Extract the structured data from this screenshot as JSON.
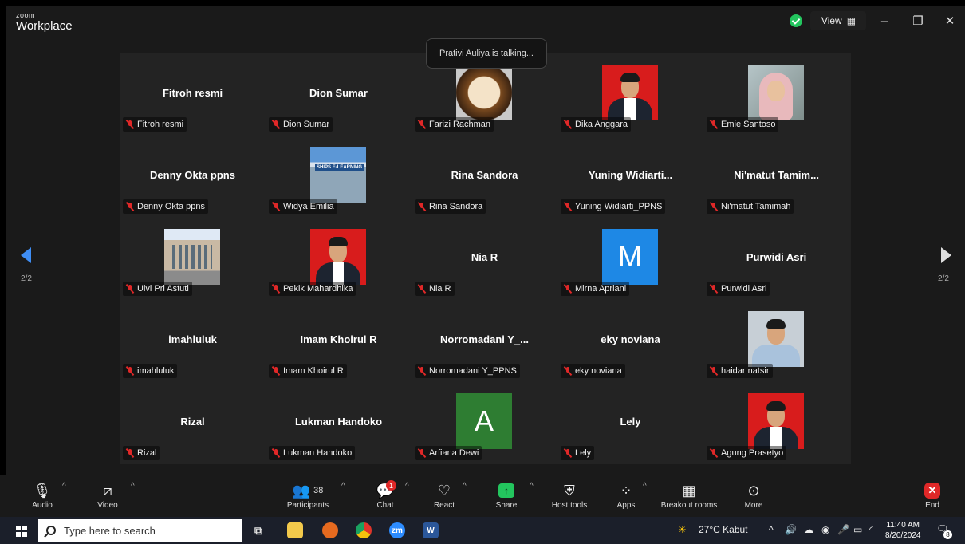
{
  "window": {
    "brand_small": "zoom",
    "brand_name": "Workplace",
    "view_label": "View",
    "minimize": "–",
    "restore": "❐",
    "close": "✕"
  },
  "talking_notice": "Prativi Auliya is talking...",
  "pagination": {
    "left": "2/2",
    "right": "2/2"
  },
  "tiles": [
    {
      "big": "Fitroh resmi",
      "label": "Fitroh resmi"
    },
    {
      "big": "Dion Sumar",
      "label": "Dion Sumar"
    },
    {
      "big": "",
      "label": "Farizi Rachman"
    },
    {
      "big": "",
      "label": "Dika Anggara"
    },
    {
      "big": "",
      "label": "Emie Santoso"
    },
    {
      "big": "Denny Okta ppns",
      "label": "Denny Okta ppns"
    },
    {
      "big": "",
      "label": "Widya Emilia",
      "photo_text": "SHIPS E-LEARNING"
    },
    {
      "big": "Rina Sandora",
      "label": "Rina Sandora"
    },
    {
      "big": "Yuning  Widiarti...",
      "label": "Yuning Widiarti_PPNS"
    },
    {
      "big": "Ni'matut  Tamim...",
      "label": "Ni'matut Tamimah"
    },
    {
      "big": "",
      "label": "Ulvi Pri Astuti"
    },
    {
      "big": "",
      "label": "Pekik Mahardhika"
    },
    {
      "big": "Nia R",
      "label": "Nia R"
    },
    {
      "big": "",
      "label": "Mirna Apriani",
      "letter": "M"
    },
    {
      "big": "Purwidi Asri",
      "label": "Purwidi Asri"
    },
    {
      "big": "imahluluk",
      "label": "imahluluk"
    },
    {
      "big": "Imam Khoirul R",
      "label": "Imam Khoirul R"
    },
    {
      "big": "Norromadani  Y_...",
      "label": "Norromadani Y_PPNS"
    },
    {
      "big": "eky noviana",
      "label": "eky noviana"
    },
    {
      "big": "",
      "label": "haidar natsir"
    },
    {
      "big": "Rizal",
      "label": "Rizal"
    },
    {
      "big": "Lukman Handoko",
      "label": "Lukman Handoko"
    },
    {
      "big": "",
      "label": "Arfiana Dewi",
      "letter": "A"
    },
    {
      "big": "Lely",
      "label": "Lely"
    },
    {
      "big": "",
      "label": "Agung Prasetyo"
    }
  ],
  "toolbar": {
    "audio": "Audio",
    "video": "Video",
    "participants": "Participants",
    "participants_count": "38",
    "chat": "Chat",
    "chat_badge": "1",
    "react": "React",
    "share": "Share",
    "host_tools": "Host tools",
    "apps": "Apps",
    "breakout": "Breakout rooms",
    "more": "More",
    "end": "End"
  },
  "taskbar": {
    "search_placeholder": "Type here to search",
    "weather": "27°C  Kabut",
    "time": "11:40 AM",
    "date": "8/20/2024",
    "notif_count": "8",
    "app_zoom": "zm",
    "app_word": "W"
  },
  "colors": {
    "accent_blue": "#3f8ef5",
    "share_green": "#23c55e",
    "end_red": "#e02828",
    "avatar_m": "#1e88e5",
    "avatar_a": "#2e7d32"
  }
}
